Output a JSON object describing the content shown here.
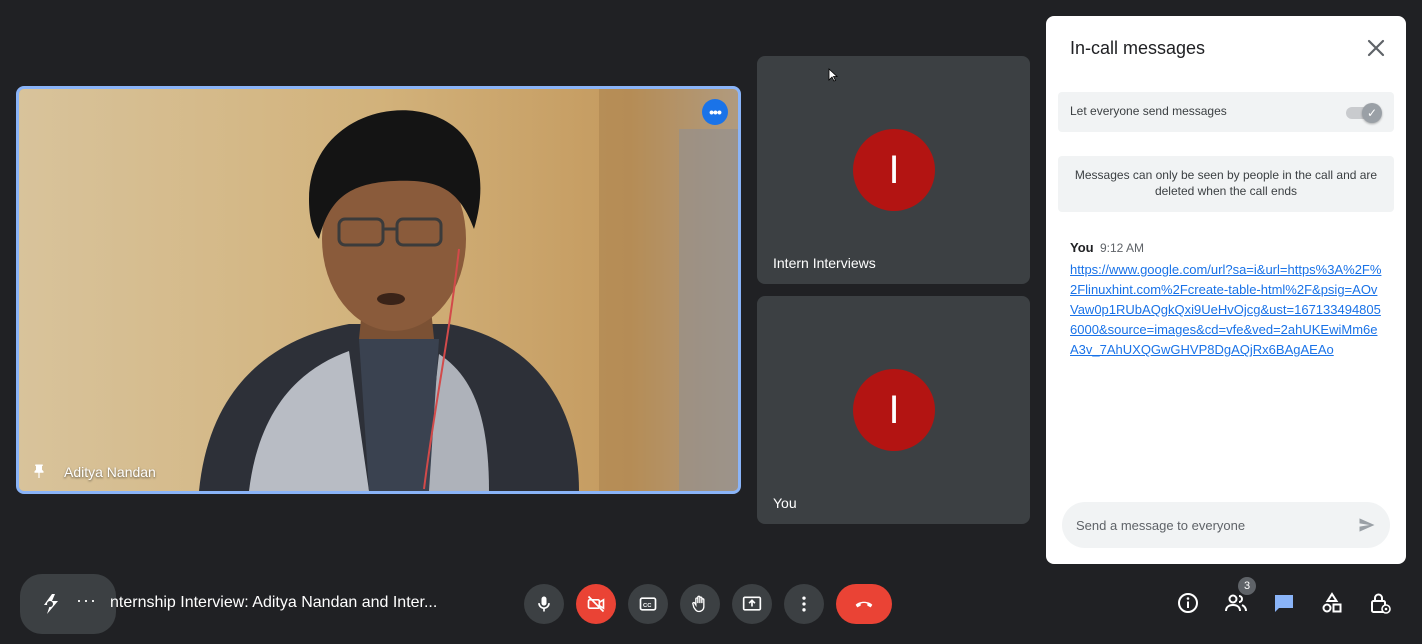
{
  "main_tile": {
    "participant_name": "Aditya Nandan",
    "menu_icon": "more-options-icon",
    "pin_icon": "pin-icon"
  },
  "side_tiles": [
    {
      "name": "Intern Interviews",
      "initial": "I",
      "avatar_color": "#b31412"
    },
    {
      "name": "You",
      "initial": "I",
      "avatar_color": "#b31412"
    }
  ],
  "chat_panel": {
    "title": "In-call messages",
    "toggle_label": "Let everyone send messages",
    "toggle_on": true,
    "notice": "Messages can only be seen by people in the call and are deleted when the call ends",
    "messages": [
      {
        "sender": "You",
        "time": "9:12 AM",
        "text": "https://www.google.com/url?sa=i&url=https%3A%2F%2Flinuxhint.com%2Fcreate-table-html%2F&psig=AOvVaw0p1RUbAQgkQxi9UeHvOjcg&ust=1671334948056000&source=images&cd=vfe&ved=2ahUKEwiMm6eA3v_7AhUXQGwGHVP8DgAQjRx6BAgAEAo"
      }
    ],
    "composer_placeholder": "Send a message to everyone"
  },
  "bottom_bar": {
    "meeting_title": "nternship Interview: Aditya Nandan and Inter...",
    "participants_count": "3",
    "controls": [
      "microphone-icon",
      "camera-off-icon",
      "captions-icon",
      "raise-hand-icon",
      "present-screen-icon",
      "more-options-icon",
      "end-call-icon"
    ],
    "right_icons": [
      "info-icon",
      "people-icon",
      "chat-icon",
      "activities-icon",
      "host-controls-icon"
    ]
  },
  "colors": {
    "background": "#202124",
    "tile": "#3c4043",
    "accent": "#8ab4f8",
    "red": "#ea4335",
    "link": "#1a73e8"
  }
}
